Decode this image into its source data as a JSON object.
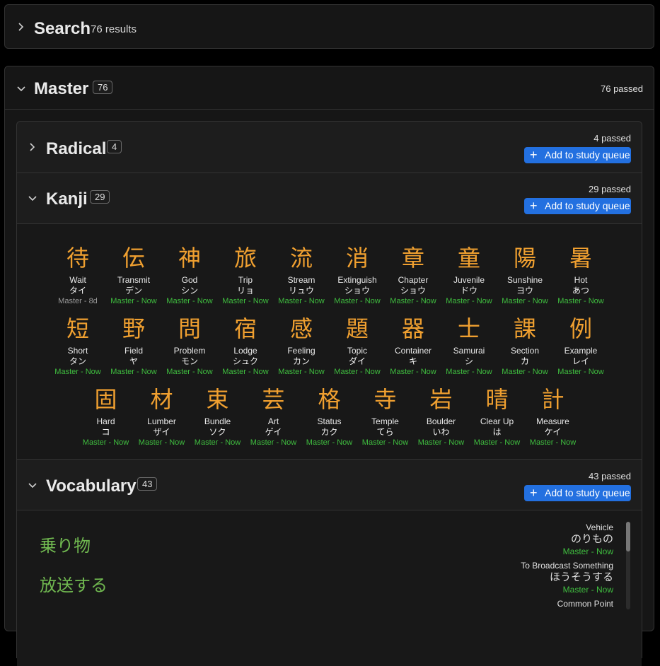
{
  "search": {
    "title": "Search",
    "count": "76 results"
  },
  "master": {
    "title": "Master",
    "badge": "76",
    "passed": "76 passed"
  },
  "radical": {
    "title": "Radical",
    "badge": "4",
    "passed": "4 passed",
    "add_label": "Add to study queue"
  },
  "kanji_section": {
    "title": "Kanji",
    "badge": "29",
    "passed": "29 passed",
    "add_label": "Add to study queue"
  },
  "vocabulary": {
    "title": "Vocabulary",
    "badge": "43",
    "passed": "43 passed",
    "add_label": "Add to study queue"
  },
  "kanji_rows": [
    [
      {
        "char": "待",
        "meaning": "Wait",
        "reading": "タイ",
        "status": "Master - 8d",
        "status_color": "#9a9a9a"
      },
      {
        "char": "伝",
        "meaning": "Transmit",
        "reading": "デン",
        "status": "Master - Now"
      },
      {
        "char": "神",
        "meaning": "God",
        "reading": "シン",
        "status": "Master - Now"
      },
      {
        "char": "旅",
        "meaning": "Trip",
        "reading": "リョ",
        "status": "Master - Now"
      },
      {
        "char": "流",
        "meaning": "Stream",
        "reading": "リュウ",
        "status": "Master - Now"
      },
      {
        "char": "消",
        "meaning": "Extinguish",
        "reading": "ショウ",
        "status": "Master - Now"
      },
      {
        "char": "章",
        "meaning": "Chapter",
        "reading": "ショウ",
        "status": "Master - Now"
      },
      {
        "char": "童",
        "meaning": "Juvenile",
        "reading": "ドウ",
        "status": "Master - Now"
      },
      {
        "char": "陽",
        "meaning": "Sunshine",
        "reading": "ヨウ",
        "status": "Master - Now"
      },
      {
        "char": "暑",
        "meaning": "Hot",
        "reading": "あつ",
        "status": "Master - Now"
      }
    ],
    [
      {
        "char": "短",
        "meaning": "Short",
        "reading": "タン",
        "status": "Master - Now"
      },
      {
        "char": "野",
        "meaning": "Field",
        "reading": "ヤ",
        "status": "Master - Now"
      },
      {
        "char": "問",
        "meaning": "Problem",
        "reading": "モン",
        "status": "Master - Now"
      },
      {
        "char": "宿",
        "meaning": "Lodge",
        "reading": "シュク",
        "status": "Master - Now"
      },
      {
        "char": "感",
        "meaning": "Feeling",
        "reading": "カン",
        "status": "Master - Now"
      },
      {
        "char": "題",
        "meaning": "Topic",
        "reading": "ダイ",
        "status": "Master - Now"
      },
      {
        "char": "器",
        "meaning": "Container",
        "reading": "キ",
        "status": "Master - Now"
      },
      {
        "char": "士",
        "meaning": "Samurai",
        "reading": "シ",
        "status": "Master - Now"
      },
      {
        "char": "課",
        "meaning": "Section",
        "reading": "カ",
        "status": "Master - Now"
      },
      {
        "char": "例",
        "meaning": "Example",
        "reading": "レイ",
        "status": "Master - Now"
      }
    ],
    [
      {
        "char": "固",
        "meaning": "Hard",
        "reading": "コ",
        "status": "Master - Now"
      },
      {
        "char": "材",
        "meaning": "Lumber",
        "reading": "ザイ",
        "status": "Master - Now"
      },
      {
        "char": "束",
        "meaning": "Bundle",
        "reading": "ソク",
        "status": "Master - Now"
      },
      {
        "char": "芸",
        "meaning": "Art",
        "reading": "ゲイ",
        "status": "Master - Now"
      },
      {
        "char": "格",
        "meaning": "Status",
        "reading": "カク",
        "status": "Master - Now"
      },
      {
        "char": "寺",
        "meaning": "Temple",
        "reading": "てら",
        "status": "Master - Now"
      },
      {
        "char": "岩",
        "meaning": "Boulder",
        "reading": "いわ",
        "status": "Master - Now"
      },
      {
        "char": "晴",
        "meaning": "Clear Up",
        "reading": "は",
        "status": "Master - Now"
      },
      {
        "char": "計",
        "meaning": "Measure",
        "reading": "ケイ",
        "status": "Master - Now"
      }
    ]
  ],
  "vocab_words": [
    "乗り物",
    "放送する"
  ],
  "vocab_list": [
    {
      "meaning": "Vehicle",
      "reading": "のりもの",
      "status": "Master - Now"
    },
    {
      "meaning": "To Broadcast Something",
      "reading": "ほうそうする",
      "status": "Master - Now"
    },
    {
      "meaning": "Common Point",
      "reading": "",
      "status": ""
    }
  ],
  "colors": {
    "accent": "#2370e0",
    "kanji": "#f0a030",
    "vocab": "#70b850",
    "status_green": "#3fbd3f"
  },
  "icons": {
    "collapsed": "chevron-right-icon",
    "expanded": "chevron-down-icon",
    "add": "plus-icon"
  }
}
